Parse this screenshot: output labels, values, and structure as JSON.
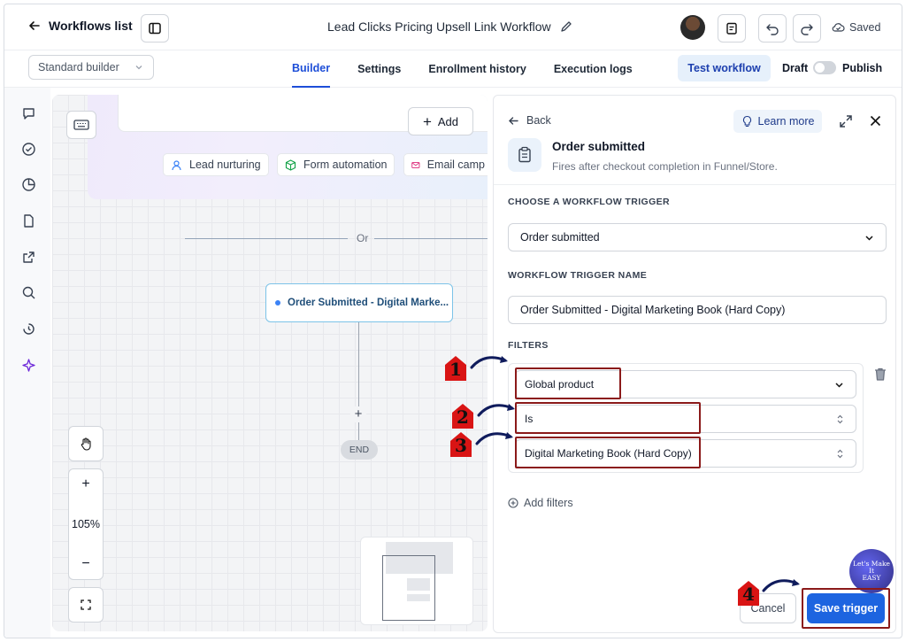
{
  "header": {
    "back_label": "Workflows list",
    "workflow_title": "Lead Clicks Pricing Upsell Link Workflow",
    "saved_label": "Saved"
  },
  "subbar": {
    "builder_select": "Standard builder",
    "tabs": [
      {
        "label": "Builder",
        "active": true
      },
      {
        "label": "Settings",
        "active": false
      },
      {
        "label": "Enrollment history",
        "active": false
      },
      {
        "label": "Execution logs",
        "active": false
      }
    ],
    "test_workflow": "Test workflow",
    "draft_label": "Draft",
    "publish_label": "Publish"
  },
  "rail_icons": [
    "chat-icon",
    "check-circle-icon",
    "pie-chart-icon",
    "file-icon",
    "external-link-icon",
    "search-icon",
    "history-icon",
    "sparkle-icon"
  ],
  "canvas": {
    "add_label": "Add",
    "chips": [
      "Lead nurturing",
      "Form automation",
      "Email camp"
    ],
    "or_label": "Or",
    "node_label": "Order Submitted - Digital Marke...",
    "plus": "+",
    "end_label": "END",
    "zoom_in": "+",
    "zoom_level": "105%",
    "zoom_out": "−"
  },
  "panel": {
    "back_label": "Back",
    "learn_more": "Learn more",
    "trigger_title": "Order submitted",
    "trigger_subtitle": "Fires after checkout completion in Funnel/Store.",
    "choose_label": "CHOOSE A WORKFLOW TRIGGER",
    "choose_value": "Order submitted",
    "name_label": "WORKFLOW TRIGGER NAME",
    "name_value": "Order Submitted - Digital Marketing Book (Hard Copy)",
    "filters_label": "FILTERS",
    "filter_field": "Global product",
    "filter_operator": "Is",
    "filter_value": "Digital Marketing Book (Hard Copy)",
    "add_filters": "Add filters",
    "cancel": "Cancel",
    "save": "Save trigger"
  },
  "annotations": {
    "steps": [
      "1",
      "2",
      "3",
      "4"
    ],
    "logo_text": "Let's Make It EASY"
  },
  "colors": {
    "accent": "#1d64e0",
    "highlight": "#8b1a1a",
    "step_badge": "#d91414"
  }
}
